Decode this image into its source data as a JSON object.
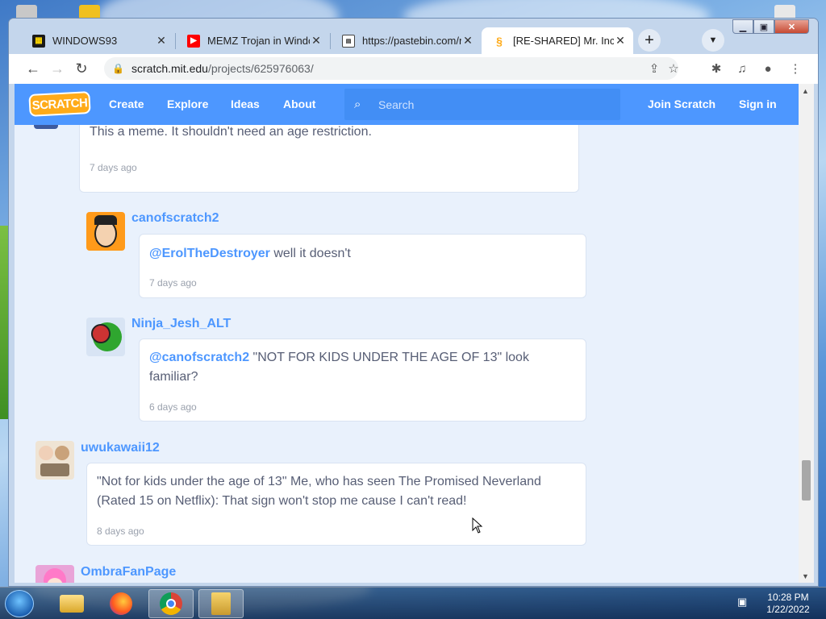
{
  "browser": {
    "tabs": [
      {
        "title": "WINDOWS93",
        "icon": "windows93-icon",
        "active": false
      },
      {
        "title": "MEMZ Trojan in Windo",
        "icon": "youtube-icon",
        "active": false
      },
      {
        "title": "https://pastebin.com/ra",
        "icon": "pastebin-icon",
        "active": false
      },
      {
        "title": "[RE-SHARED] Mr. Incre",
        "icon": "scratch-icon",
        "active": true
      }
    ],
    "new_tab": "+",
    "url_host": "scratch.mit.edu",
    "url_path": "/projects/625976063/"
  },
  "scratch_nav": {
    "logo": "SCRATCH",
    "links": [
      "Create",
      "Explore",
      "Ideas",
      "About"
    ],
    "search_placeholder": "Search",
    "join": "Join Scratch",
    "signin": "Sign in"
  },
  "comments": [
    {
      "text": "This a meme. It shouldn't need an age restriction.",
      "time": "7 days ago"
    },
    {
      "user": "canofscratch2",
      "mention": "@ErolTheDestroyer",
      "text": " well it doesn't",
      "time": "7 days ago"
    },
    {
      "user": "Ninja_Jesh_ALT",
      "mention": "@canofscratch2",
      "text_line1": " \"NOT FOR KIDS UNDER THE AGE OF 13\" look",
      "text_line2": "familiar?",
      "time": "6 days ago"
    },
    {
      "user": "uwukawaii12",
      "text_line1": "\"Not for kids under the age of 13\" Me, who has seen The Promised Neverland",
      "text_line2": "(Rated 15 on Netflix): That sign won't stop me cause I can't read!",
      "time": "8 days ago"
    },
    {
      "user": "OmbraFanPage"
    }
  ],
  "taskbar": {
    "time": "10:28 PM",
    "date": "1/22/2022"
  },
  "colors": {
    "scratch_blue": "#4d97ff",
    "scratch_orange": "#ffab19",
    "comment_text": "#575e75"
  }
}
